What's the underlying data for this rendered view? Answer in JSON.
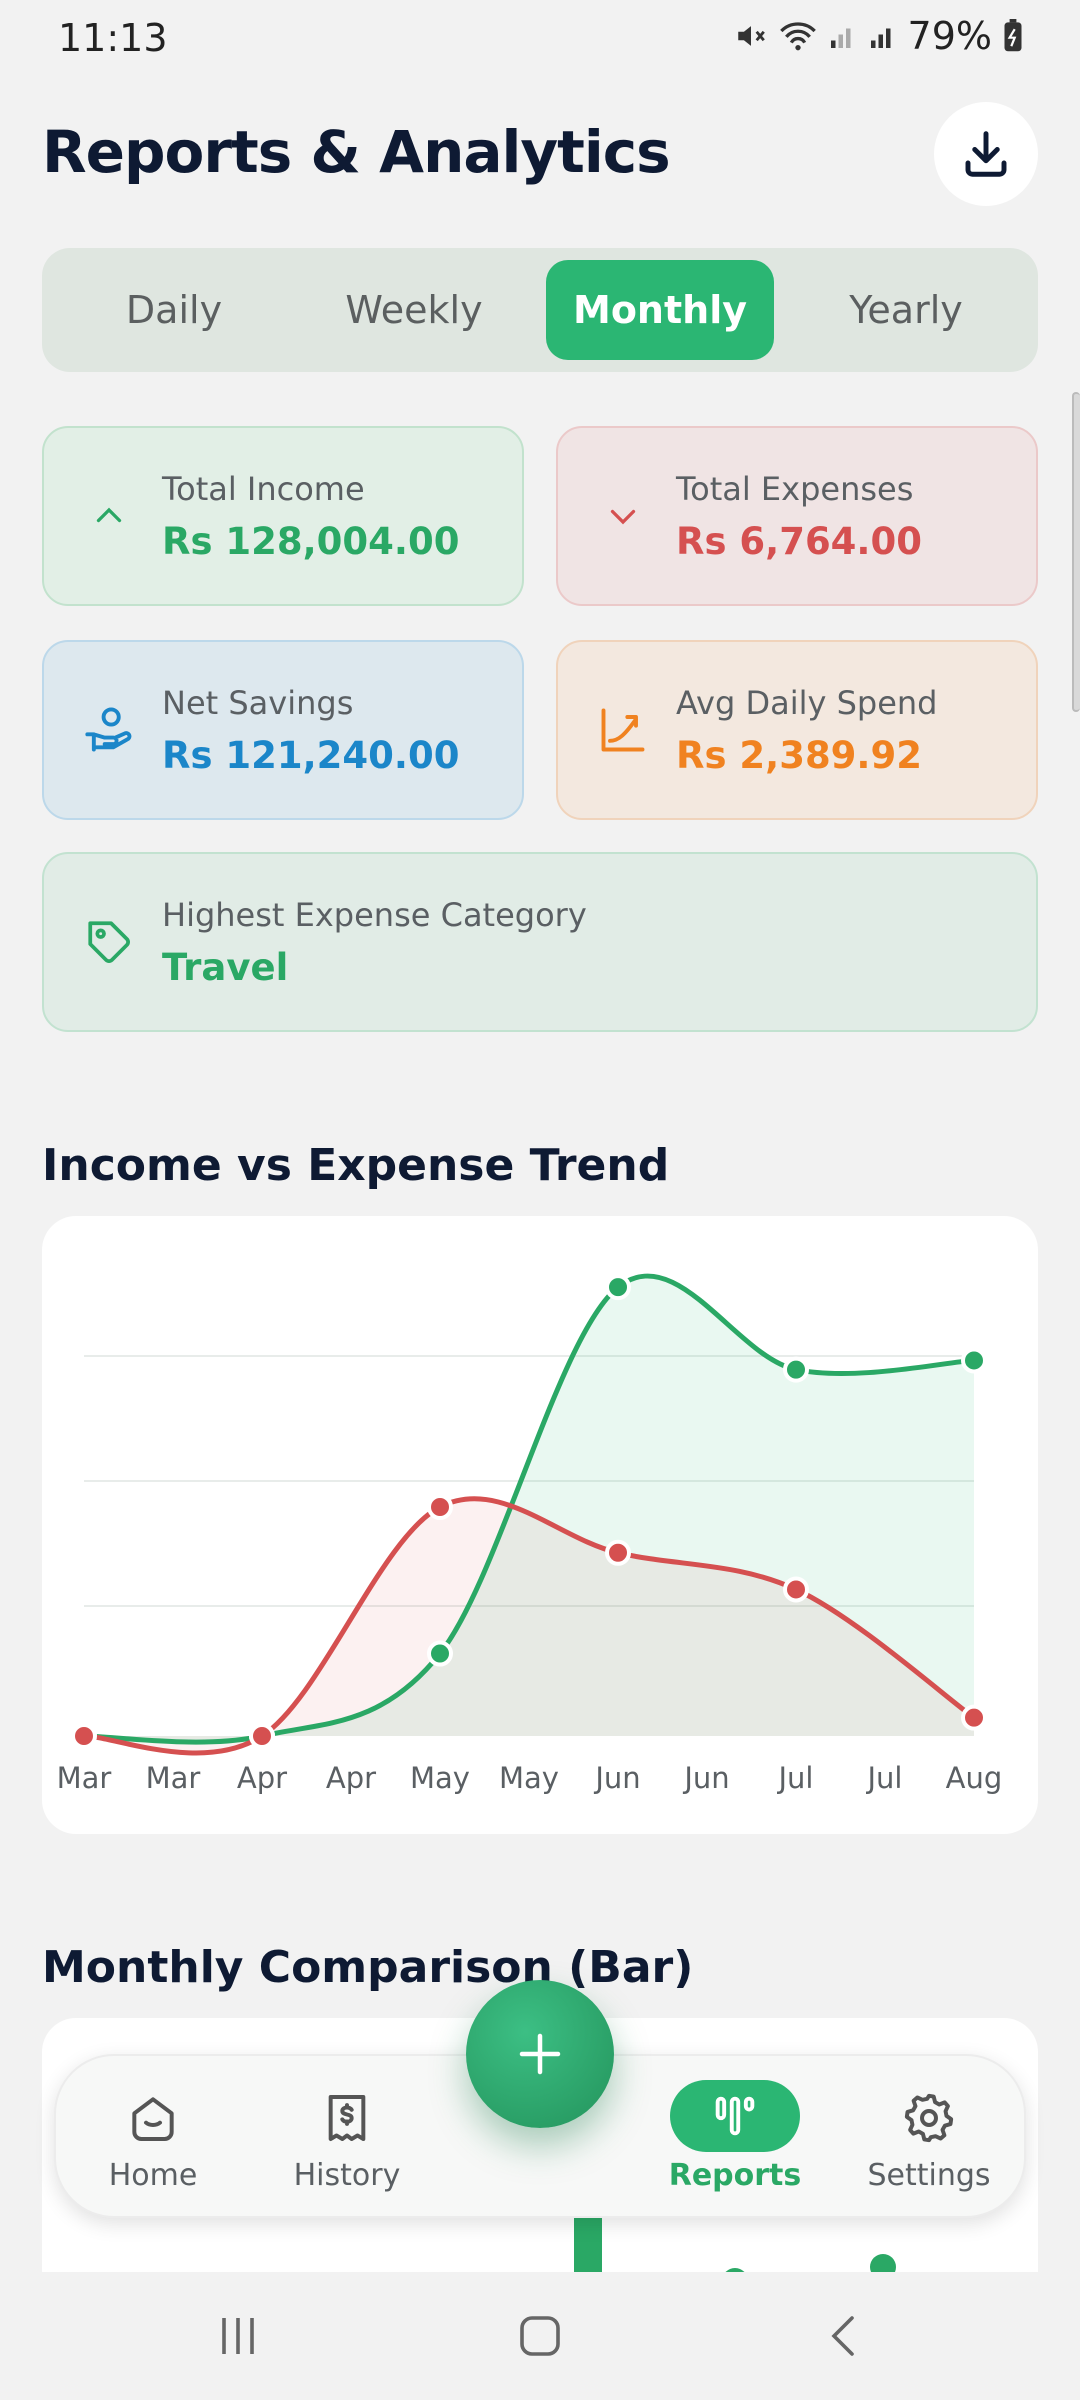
{
  "status": {
    "time": "11:13",
    "battery": "79%"
  },
  "header": {
    "title": "Reports & Analytics"
  },
  "tabs": [
    {
      "label": "Daily",
      "active": false
    },
    {
      "label": "Weekly",
      "active": false
    },
    {
      "label": "Monthly",
      "active": true
    },
    {
      "label": "Yearly",
      "active": false
    }
  ],
  "stats": {
    "income": {
      "label": "Total Income",
      "value": "Rs 128,004.00"
    },
    "expense": {
      "label": "Total Expenses",
      "value": "Rs 6,764.00"
    },
    "net": {
      "label": "Net Savings",
      "value": "Rs 121,240.00"
    },
    "avg": {
      "label": "Avg Daily Spend",
      "value": "Rs 2,389.92"
    },
    "highest": {
      "label": "Highest Expense Category",
      "value": "Travel"
    }
  },
  "sections": {
    "trend_title": "Income vs Expense Trend",
    "bar_title": "Monthly Comparison (Bar)"
  },
  "chart_data": {
    "type": "line",
    "x": [
      "Mar",
      "Mar",
      "Apr",
      "Apr",
      "May",
      "May",
      "Jun",
      "Jun",
      "Jul",
      "Jul",
      "Aug"
    ],
    "series": [
      {
        "name": "Income",
        "color": "#2aa865",
        "points": [
          [
            0,
            0
          ],
          [
            2,
            0
          ],
          [
            4,
            18
          ],
          [
            6,
            98
          ],
          [
            8,
            80
          ],
          [
            10,
            82
          ]
        ]
      },
      {
        "name": "Expense",
        "color": "#d55050",
        "points": [
          [
            0,
            0
          ],
          [
            2,
            0
          ],
          [
            4,
            50
          ],
          [
            6,
            40
          ],
          [
            8,
            32
          ],
          [
            10,
            4
          ]
        ]
      }
    ],
    "ylim": [
      0,
      100
    ],
    "grid": true
  },
  "nav": {
    "items": [
      {
        "label": "Home",
        "icon": "home-icon",
        "active": false
      },
      {
        "label": "History",
        "icon": "receipt-icon",
        "active": false
      },
      {
        "label": "Reports",
        "icon": "reports-icon",
        "active": true
      },
      {
        "label": "Settings",
        "icon": "gear-icon",
        "active": false
      }
    ],
    "fab_icon": "plus-icon"
  },
  "colors": {
    "accent": "#2bb673",
    "income": "#2aa865",
    "expense": "#d55050",
    "net": "#1b86c9",
    "avg": "#f08220"
  }
}
